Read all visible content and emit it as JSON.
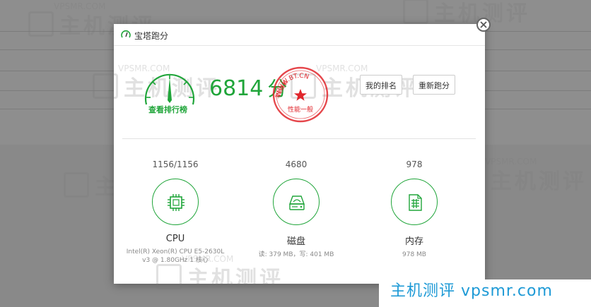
{
  "dialog": {
    "title": "宝塔跑分",
    "gauge_link": "查看排行榜",
    "score": "6814",
    "score_unit": "分",
    "stamp": {
      "text_top": "WWW.BT.CN",
      "text_left": "宝塔面板",
      "text_bottom": "性能一般"
    },
    "buttons": {
      "rank": "我的排名",
      "rerun": "重新跑分"
    },
    "metrics": [
      {
        "value": "1156/1156",
        "name": "CPU",
        "detail": "Intel(R) Xeon(R) CPU E5-2630L v3 @ 1.80GHz 1 核心",
        "icon": "cpu-chip-icon"
      },
      {
        "value": "4680",
        "name": "磁盘",
        "detail": "读: 379 MB，写: 401 MB",
        "icon": "disk-drive-icon"
      },
      {
        "value": "978",
        "name": "内存",
        "detail": "978 MB",
        "icon": "memory-document-icon"
      }
    ]
  },
  "watermark": {
    "en": "VPSMR.COM",
    "cn": "主机测评"
  },
  "brand": "主机测评 vpsmr.com",
  "colors": {
    "accent": "#20a53a",
    "stamp": "#e0262c",
    "brand": "#1e9ad6"
  }
}
